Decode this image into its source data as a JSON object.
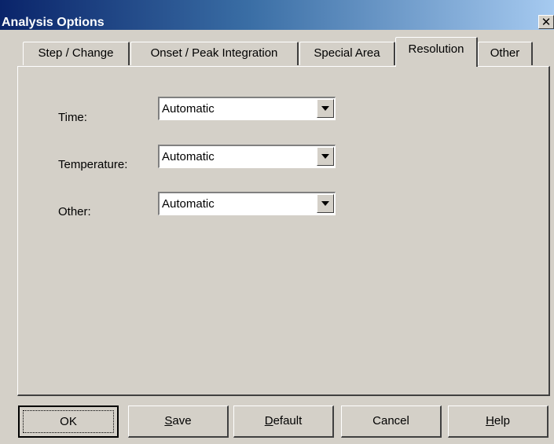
{
  "window": {
    "title": "Analysis Options",
    "close_glyph": "✕"
  },
  "tabs": [
    {
      "label": "Step / Change"
    },
    {
      "label": "Onset / Peak Integration"
    },
    {
      "label": "Special Area"
    },
    {
      "label": "Resolution",
      "active": true
    },
    {
      "label": "Other"
    }
  ],
  "resolution": {
    "fields": [
      {
        "label": "Time:",
        "value": "Automatic"
      },
      {
        "label": "Temperature:",
        "value": "Automatic"
      },
      {
        "label": "Other:",
        "value": "Automatic"
      }
    ]
  },
  "buttons": [
    {
      "label": "OK",
      "default": true
    },
    {
      "label": "Save",
      "accel": "S"
    },
    {
      "label": "Default",
      "accel": "D"
    },
    {
      "label": "Cancel"
    },
    {
      "label": "Help",
      "accel": "H"
    }
  ],
  "colors": {
    "dialog_face": "#d4d0c8",
    "title_gradient_start": "#0a246a",
    "title_gradient_end": "#a6caf0",
    "title_text": "#ffffff"
  }
}
